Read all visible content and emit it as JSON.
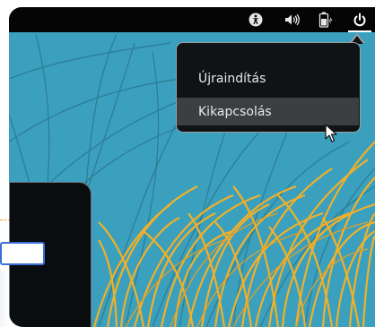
{
  "topbar": {
    "icons": [
      {
        "name": "accessibility-icon"
      },
      {
        "name": "volume-icon"
      },
      {
        "name": "battery-icon"
      },
      {
        "name": "power-icon"
      }
    ]
  },
  "power_menu": {
    "items": [
      {
        "label": "Újraindítás"
      },
      {
        "label": "Kikapcsolás"
      }
    ],
    "highlighted_index": 1
  },
  "login": {
    "input_value": ""
  },
  "colors": {
    "wallpaper": "#3aa0bd",
    "grass": "#f0b02a",
    "menu_bg": "#101316",
    "highlight": "#3b3f42",
    "focus": "#3c6fd3"
  }
}
